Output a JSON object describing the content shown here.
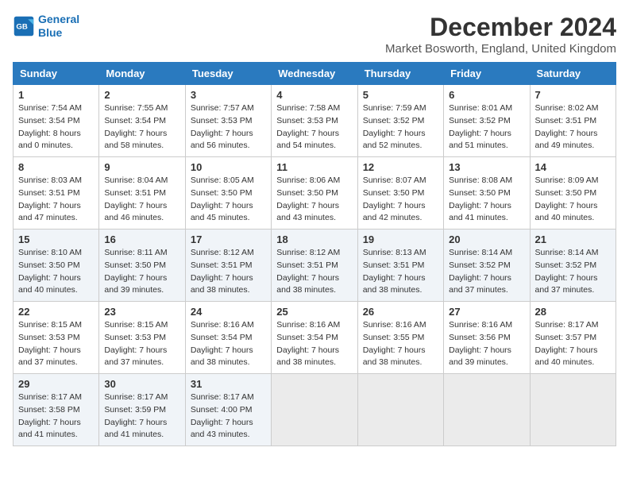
{
  "logo": {
    "line1": "General",
    "line2": "Blue"
  },
  "title": "December 2024",
  "location": "Market Bosworth, England, United Kingdom",
  "weekdays": [
    "Sunday",
    "Monday",
    "Tuesday",
    "Wednesday",
    "Thursday",
    "Friday",
    "Saturday"
  ],
  "weeks": [
    [
      {
        "day": "1",
        "sunrise": "Sunrise: 7:54 AM",
        "sunset": "Sunset: 3:54 PM",
        "daylight": "Daylight: 8 hours and 0 minutes."
      },
      {
        "day": "2",
        "sunrise": "Sunrise: 7:55 AM",
        "sunset": "Sunset: 3:54 PM",
        "daylight": "Daylight: 7 hours and 58 minutes."
      },
      {
        "day": "3",
        "sunrise": "Sunrise: 7:57 AM",
        "sunset": "Sunset: 3:53 PM",
        "daylight": "Daylight: 7 hours and 56 minutes."
      },
      {
        "day": "4",
        "sunrise": "Sunrise: 7:58 AM",
        "sunset": "Sunset: 3:53 PM",
        "daylight": "Daylight: 7 hours and 54 minutes."
      },
      {
        "day": "5",
        "sunrise": "Sunrise: 7:59 AM",
        "sunset": "Sunset: 3:52 PM",
        "daylight": "Daylight: 7 hours and 52 minutes."
      },
      {
        "day": "6",
        "sunrise": "Sunrise: 8:01 AM",
        "sunset": "Sunset: 3:52 PM",
        "daylight": "Daylight: 7 hours and 51 minutes."
      },
      {
        "day": "7",
        "sunrise": "Sunrise: 8:02 AM",
        "sunset": "Sunset: 3:51 PM",
        "daylight": "Daylight: 7 hours and 49 minutes."
      }
    ],
    [
      {
        "day": "8",
        "sunrise": "Sunrise: 8:03 AM",
        "sunset": "Sunset: 3:51 PM",
        "daylight": "Daylight: 7 hours and 47 minutes."
      },
      {
        "day": "9",
        "sunrise": "Sunrise: 8:04 AM",
        "sunset": "Sunset: 3:51 PM",
        "daylight": "Daylight: 7 hours and 46 minutes."
      },
      {
        "day": "10",
        "sunrise": "Sunrise: 8:05 AM",
        "sunset": "Sunset: 3:50 PM",
        "daylight": "Daylight: 7 hours and 45 minutes."
      },
      {
        "day": "11",
        "sunrise": "Sunrise: 8:06 AM",
        "sunset": "Sunset: 3:50 PM",
        "daylight": "Daylight: 7 hours and 43 minutes."
      },
      {
        "day": "12",
        "sunrise": "Sunrise: 8:07 AM",
        "sunset": "Sunset: 3:50 PM",
        "daylight": "Daylight: 7 hours and 42 minutes."
      },
      {
        "day": "13",
        "sunrise": "Sunrise: 8:08 AM",
        "sunset": "Sunset: 3:50 PM",
        "daylight": "Daylight: 7 hours and 41 minutes."
      },
      {
        "day": "14",
        "sunrise": "Sunrise: 8:09 AM",
        "sunset": "Sunset: 3:50 PM",
        "daylight": "Daylight: 7 hours and 40 minutes."
      }
    ],
    [
      {
        "day": "15",
        "sunrise": "Sunrise: 8:10 AM",
        "sunset": "Sunset: 3:50 PM",
        "daylight": "Daylight: 7 hours and 40 minutes."
      },
      {
        "day": "16",
        "sunrise": "Sunrise: 8:11 AM",
        "sunset": "Sunset: 3:50 PM",
        "daylight": "Daylight: 7 hours and 39 minutes."
      },
      {
        "day": "17",
        "sunrise": "Sunrise: 8:12 AM",
        "sunset": "Sunset: 3:51 PM",
        "daylight": "Daylight: 7 hours and 38 minutes."
      },
      {
        "day": "18",
        "sunrise": "Sunrise: 8:12 AM",
        "sunset": "Sunset: 3:51 PM",
        "daylight": "Daylight: 7 hours and 38 minutes."
      },
      {
        "day": "19",
        "sunrise": "Sunrise: 8:13 AM",
        "sunset": "Sunset: 3:51 PM",
        "daylight": "Daylight: 7 hours and 38 minutes."
      },
      {
        "day": "20",
        "sunrise": "Sunrise: 8:14 AM",
        "sunset": "Sunset: 3:52 PM",
        "daylight": "Daylight: 7 hours and 37 minutes."
      },
      {
        "day": "21",
        "sunrise": "Sunrise: 8:14 AM",
        "sunset": "Sunset: 3:52 PM",
        "daylight": "Daylight: 7 hours and 37 minutes."
      }
    ],
    [
      {
        "day": "22",
        "sunrise": "Sunrise: 8:15 AM",
        "sunset": "Sunset: 3:53 PM",
        "daylight": "Daylight: 7 hours and 37 minutes."
      },
      {
        "day": "23",
        "sunrise": "Sunrise: 8:15 AM",
        "sunset": "Sunset: 3:53 PM",
        "daylight": "Daylight: 7 hours and 37 minutes."
      },
      {
        "day": "24",
        "sunrise": "Sunrise: 8:16 AM",
        "sunset": "Sunset: 3:54 PM",
        "daylight": "Daylight: 7 hours and 38 minutes."
      },
      {
        "day": "25",
        "sunrise": "Sunrise: 8:16 AM",
        "sunset": "Sunset: 3:54 PM",
        "daylight": "Daylight: 7 hours and 38 minutes."
      },
      {
        "day": "26",
        "sunrise": "Sunrise: 8:16 AM",
        "sunset": "Sunset: 3:55 PM",
        "daylight": "Daylight: 7 hours and 38 minutes."
      },
      {
        "day": "27",
        "sunrise": "Sunrise: 8:16 AM",
        "sunset": "Sunset: 3:56 PM",
        "daylight": "Daylight: 7 hours and 39 minutes."
      },
      {
        "day": "28",
        "sunrise": "Sunrise: 8:17 AM",
        "sunset": "Sunset: 3:57 PM",
        "daylight": "Daylight: 7 hours and 40 minutes."
      }
    ],
    [
      {
        "day": "29",
        "sunrise": "Sunrise: 8:17 AM",
        "sunset": "Sunset: 3:58 PM",
        "daylight": "Daylight: 7 hours and 41 minutes."
      },
      {
        "day": "30",
        "sunrise": "Sunrise: 8:17 AM",
        "sunset": "Sunset: 3:59 PM",
        "daylight": "Daylight: 7 hours and 41 minutes."
      },
      {
        "day": "31",
        "sunrise": "Sunrise: 8:17 AM",
        "sunset": "Sunset: 4:00 PM",
        "daylight": "Daylight: 7 hours and 43 minutes."
      },
      null,
      null,
      null,
      null
    ]
  ]
}
